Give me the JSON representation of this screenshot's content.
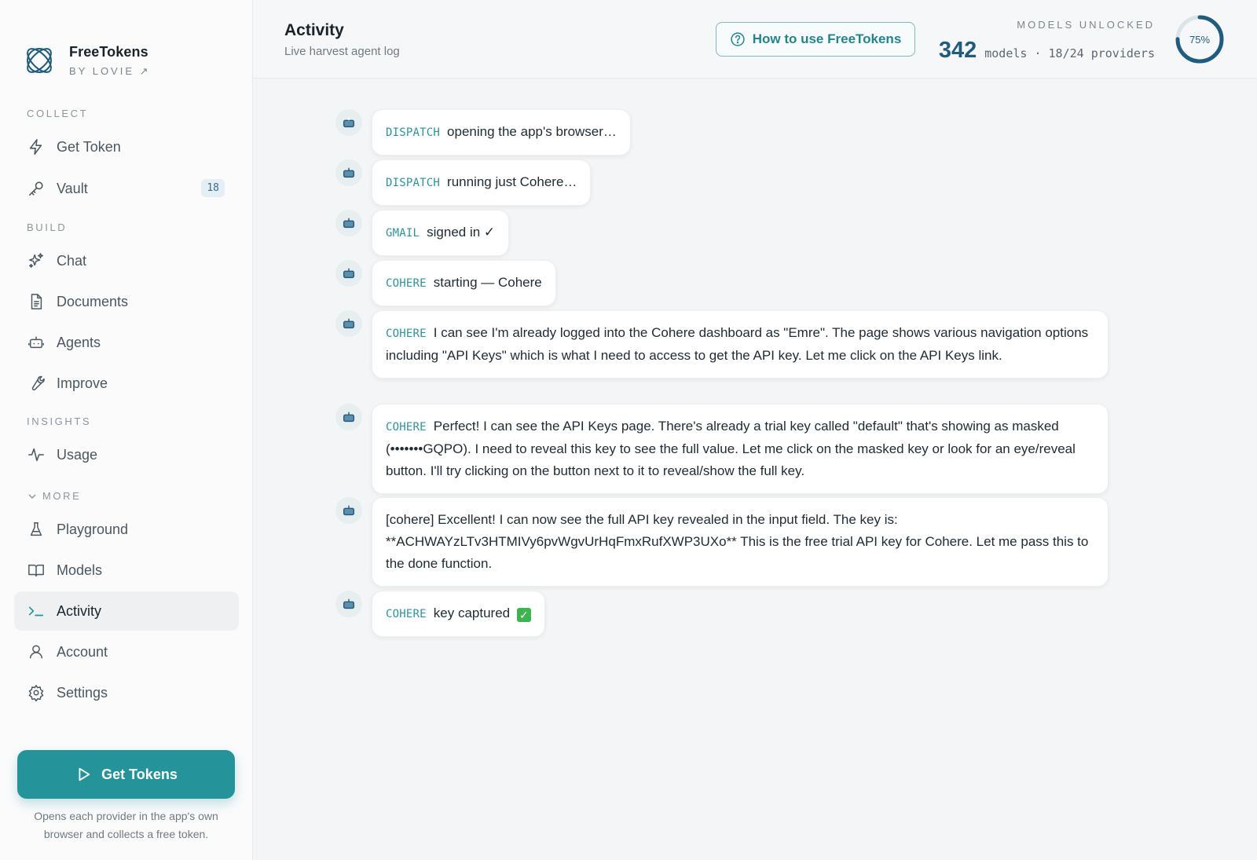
{
  "brand": {
    "name": "FreeTokens",
    "by": "BY LOVIE ↗"
  },
  "sidebar": {
    "sections": {
      "collect": "COLLECT",
      "build": "BUILD",
      "insights": "INSIGHTS",
      "more": "MORE"
    },
    "items": {
      "get_token": {
        "label": "Get Token",
        "icon": "lightning-icon"
      },
      "vault": {
        "label": "Vault",
        "icon": "key-icon",
        "badge": "18"
      },
      "chat": {
        "label": "Chat",
        "icon": "sparkles-icon"
      },
      "documents": {
        "label": "Documents",
        "icon": "document-icon"
      },
      "agents": {
        "label": "Agents",
        "icon": "bot-icon"
      },
      "improve": {
        "label": "Improve",
        "icon": "wrench-icon"
      },
      "usage": {
        "label": "Usage",
        "icon": "activity-pulse-icon"
      },
      "playground": {
        "label": "Playground",
        "icon": "flask-icon"
      },
      "models": {
        "label": "Models",
        "icon": "book-icon"
      },
      "activity": {
        "label": "Activity",
        "icon": "terminal-icon"
      },
      "account": {
        "label": "Account",
        "icon": "user-icon"
      },
      "settings": {
        "label": "Settings",
        "icon": "gear-icon"
      }
    },
    "cta": {
      "label": "Get Tokens",
      "note": "Opens each provider in the app's own browser and collects a free token."
    }
  },
  "header": {
    "title": "Activity",
    "subtitle": "Live harvest agent log",
    "help_button": "How to use FreeTokens",
    "stats_label": "MODELS UNLOCKED",
    "models_count": "342",
    "models_rest": "models · 18/24 providers",
    "gauge_text": "75%",
    "gauge_value": 0.75
  },
  "log": [
    {
      "tag": "DISPATCH",
      "text": "opening the app's browser…"
    },
    {
      "tag": "DISPATCH",
      "text": "running just Cohere…"
    },
    {
      "tag": "GMAIL",
      "text": "signed in ✓"
    },
    {
      "tag": "COHERE",
      "text": "starting — Cohere"
    },
    {
      "tag": "COHERE",
      "text": "I can see I'm already logged into the Cohere dashboard as \"Emre\". The page shows various navigation options including \"API Keys\" which is what I need to access to get the API key. Let me click on the API Keys link."
    },
    {
      "tag": "COHERE",
      "text": "Perfect! I can see the API Keys page. There's already a trial key called \"default\" that's showing as masked (•••••••GQPO). I need to reveal this key to see the full value. Let me click on the masked key or look for an eye/reveal button. I'll try clicking on the button next to it to reveal/show the full key."
    },
    {
      "tag": "",
      "text": "[cohere] Excellent! I can now see the full API key revealed in the input field. The key is: **ACHWAYzLTv3HTMIVy6pvWgvUrHqFmxRufXWP3UXo** This is the free trial API key for Cohere. Let me pass this to the done function."
    },
    {
      "tag": "COHERE",
      "text": "key captured"
    }
  ],
  "colors": {
    "accent": "#25939a",
    "navy": "#1f5c7e",
    "tag": "#2f9199",
    "check": "#3fb34f"
  }
}
